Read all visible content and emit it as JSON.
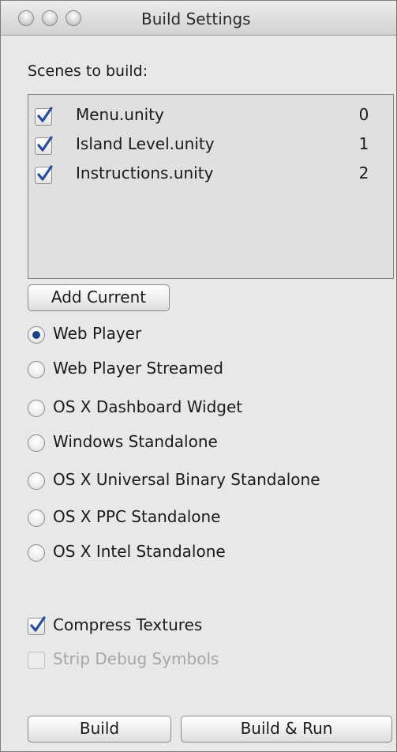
{
  "window": {
    "title": "Build Settings"
  },
  "scenes_label": "Scenes to build:",
  "scenes": [
    {
      "name": "Menu.unity",
      "index": "0",
      "checked": true
    },
    {
      "name": "Island Level.unity",
      "index": "1",
      "checked": true
    },
    {
      "name": "Instructions.unity",
      "index": "2",
      "checked": true
    }
  ],
  "add_current_label": "Add Current",
  "platforms": [
    {
      "label": "Web Player",
      "selected": true
    },
    {
      "label": "Web Player Streamed",
      "selected": false
    },
    {
      "label": "OS X Dashboard Widget",
      "selected": false
    },
    {
      "label": "Windows Standalone",
      "selected": false
    },
    {
      "label": "OS X Universal Binary Standalone",
      "selected": false
    },
    {
      "label": "OS X PPC Standalone",
      "selected": false
    },
    {
      "label": "OS X Intel Standalone",
      "selected": false
    }
  ],
  "options": {
    "compress_textures": {
      "label": "Compress Textures",
      "checked": true,
      "enabled": true
    },
    "strip_debug_symbols": {
      "label": "Strip Debug Symbols",
      "checked": false,
      "enabled": false
    }
  },
  "buttons": {
    "build": "Build",
    "build_and_run": "Build & Run"
  },
  "colors": {
    "check_accent": "#2a4d9b",
    "radio_dot": "#1e3f8a",
    "window_bg": "#e8e8e8"
  }
}
